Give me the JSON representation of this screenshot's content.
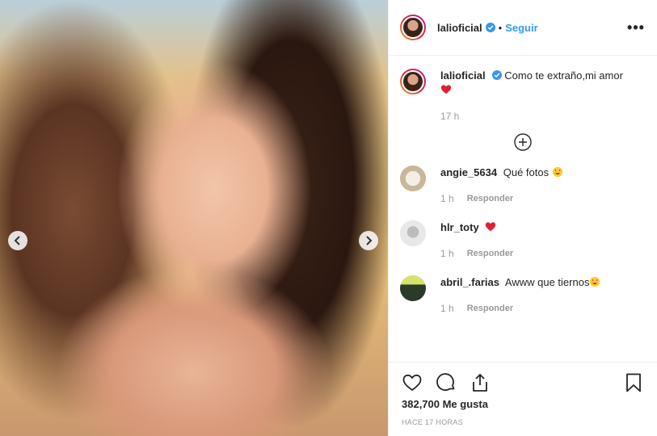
{
  "post": {
    "author": "lalioficial",
    "follow_label": "Seguir",
    "separator": "•",
    "caption": {
      "username": "lalioficial",
      "text": "Como te extraño,mi amor",
      "time": "17 h"
    },
    "comments": [
      {
        "username": "angie_5634",
        "text": "Qué fotos",
        "emoji": "star-struck-emoji",
        "time": "1 h",
        "reply_label": "Responder"
      },
      {
        "username": "hlr_toty",
        "text": "",
        "emoji": "red-heart-emoji",
        "time": "1 h",
        "reply_label": "Responder"
      },
      {
        "username": "abril_.farias",
        "text": "Awww que tiernos",
        "emoji": "star-struck-emoji",
        "time": "1 h",
        "reply_label": "Responder"
      }
    ],
    "likes": "382,700 Me gusta",
    "posted": "HACE 17 HORAS"
  },
  "colors": {
    "accent": "#3897f0",
    "heart": "#ed4956",
    "muted": "#999999"
  }
}
